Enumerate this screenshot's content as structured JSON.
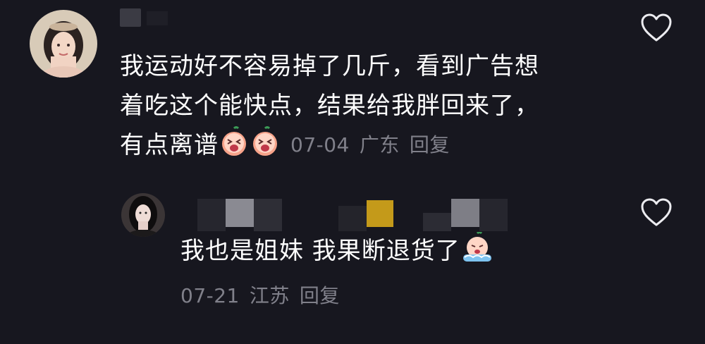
{
  "comments": [
    {
      "text_lines": [
        "我运动好不容易掉了几斤，看到广告想",
        "着吃这个能快点，结果给我胖回来了，",
        "有点离谱"
      ],
      "emojis": [
        "laugh-cry-peach-emoji",
        "laugh-cry-peach-emoji"
      ],
      "date": "07-04",
      "location": "广东",
      "reply_label": "回复"
    },
    {
      "text": "我也是姐妹 我果断退货了",
      "emojis": [
        "crying-peach-emoji"
      ],
      "date": "07-21",
      "location": "江苏",
      "reply_label": "回复"
    }
  ],
  "colors": {
    "background": "#17171f",
    "meta": "#80808a",
    "text": "#ffffff",
    "peach": "#f7a38a"
  }
}
